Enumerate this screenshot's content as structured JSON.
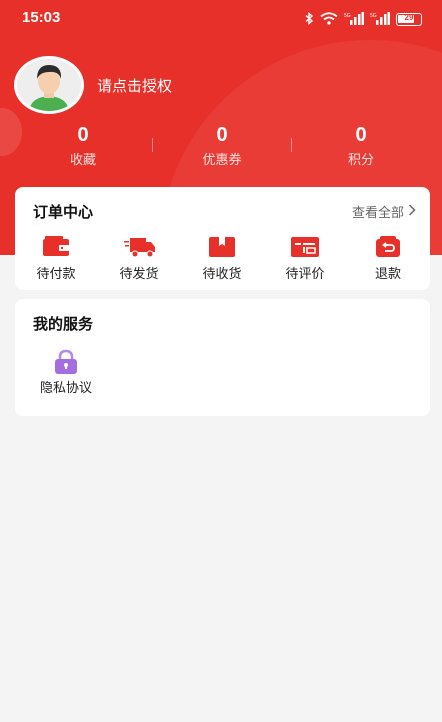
{
  "status_bar": {
    "time": "15:03",
    "battery": "29"
  },
  "profile": {
    "username": "请点击授权"
  },
  "stats": [
    {
      "value": "0",
      "label": "收藏"
    },
    {
      "value": "0",
      "label": "优惠券"
    },
    {
      "value": "0",
      "label": "积分"
    }
  ],
  "orders": {
    "title": "订单中心",
    "view_all": "查看全部",
    "items": [
      {
        "label": "待付款",
        "icon": "wallet-icon"
      },
      {
        "label": "待发货",
        "icon": "truck-icon"
      },
      {
        "label": "待收货",
        "icon": "box-icon"
      },
      {
        "label": "待评价",
        "icon": "review-icon"
      },
      {
        "label": "退款",
        "icon": "refund-icon"
      }
    ]
  },
  "services": {
    "title": "我的服务",
    "items": [
      {
        "label": "隐私协议",
        "icon": "lock-icon"
      }
    ]
  },
  "colors": {
    "primary": "#e8302a",
    "service_icon": "#a46ee0"
  }
}
